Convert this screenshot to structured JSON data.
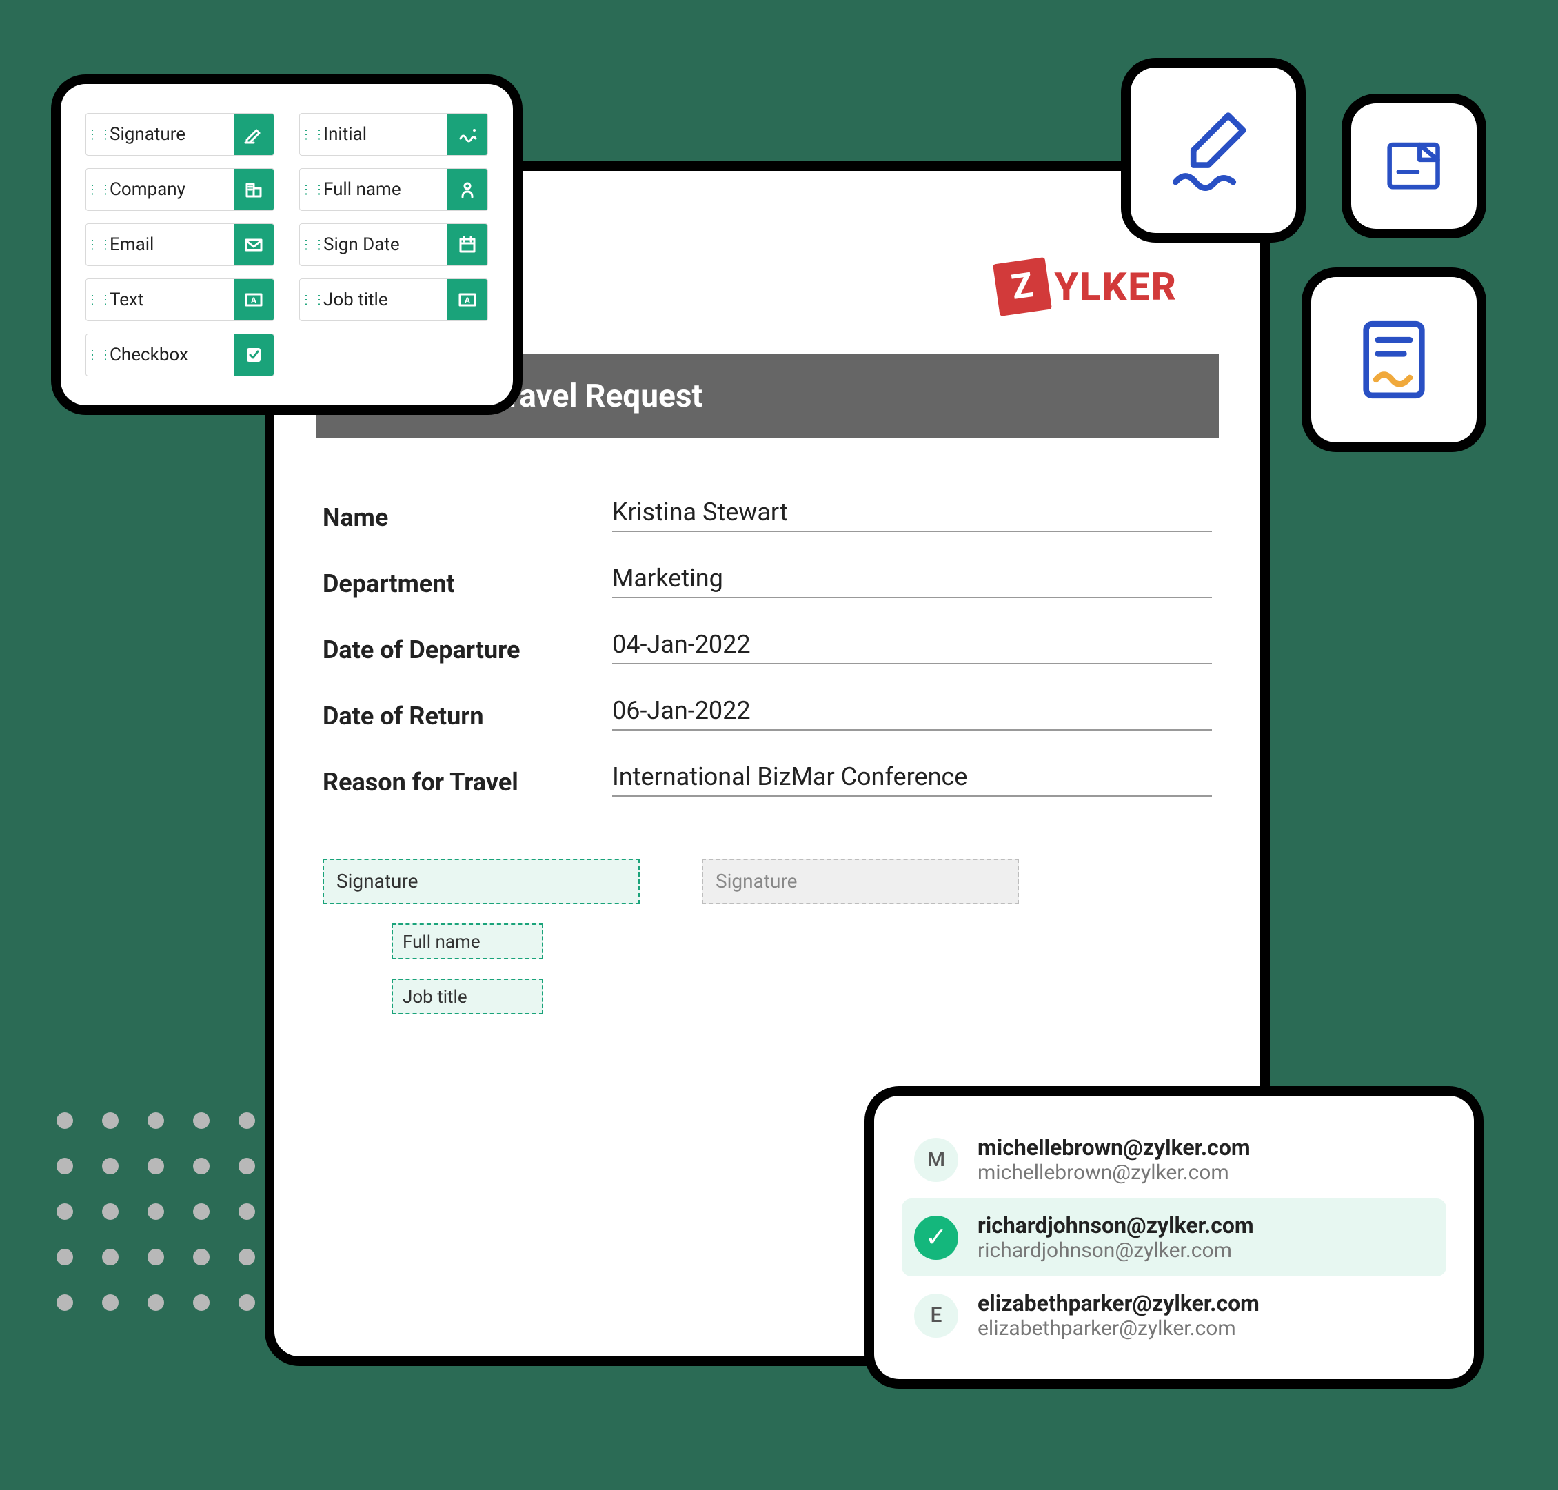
{
  "palette": {
    "fields": [
      {
        "label": "Signature",
        "icon": "signature"
      },
      {
        "label": "Initial",
        "icon": "initial"
      },
      {
        "label": "Company",
        "icon": "company"
      },
      {
        "label": "Full name",
        "icon": "person"
      },
      {
        "label": "Email",
        "icon": "email"
      },
      {
        "label": "Sign Date",
        "icon": "calendar"
      },
      {
        "label": "Text",
        "icon": "textbox"
      },
      {
        "label": "Job title",
        "icon": "textbox"
      },
      {
        "label": "Checkbox",
        "icon": "checkbox"
      }
    ]
  },
  "document": {
    "brand": "YLKER",
    "brand_initial": "Z",
    "title": "Employee Travel Request",
    "rows": [
      {
        "label": "Name",
        "value": "Kristina Stewart"
      },
      {
        "label": "Department",
        "value": "Marketing"
      },
      {
        "label": "Date of Departure",
        "value": "04-Jan-2022"
      },
      {
        "label": "Date of Return",
        "value": "06-Jan-2022"
      },
      {
        "label": "Reason for Travel",
        "value": "International BizMar Conference"
      }
    ],
    "placeholders": {
      "signer1_sig": "Signature",
      "signer1_name": "Full name",
      "signer1_title": "Job title",
      "signer2_sig": "Signature"
    }
  },
  "recipients": [
    {
      "initial": "M",
      "name": "michellebrown@zylker.com",
      "sub": "michellebrown@zylker.com",
      "selected": false
    },
    {
      "initial": "✓",
      "name": "richardjohnson@zylker.com",
      "sub": "richardjohnson@zylker.com",
      "selected": true
    },
    {
      "initial": "E",
      "name": "elizabethparker@zylker.com",
      "sub": "elizabethparker@zylker.com",
      "selected": false
    }
  ],
  "icon_cards": {
    "sign": "sign-icon",
    "send": "send-doc-icon",
    "doc": "signed-doc-icon"
  }
}
